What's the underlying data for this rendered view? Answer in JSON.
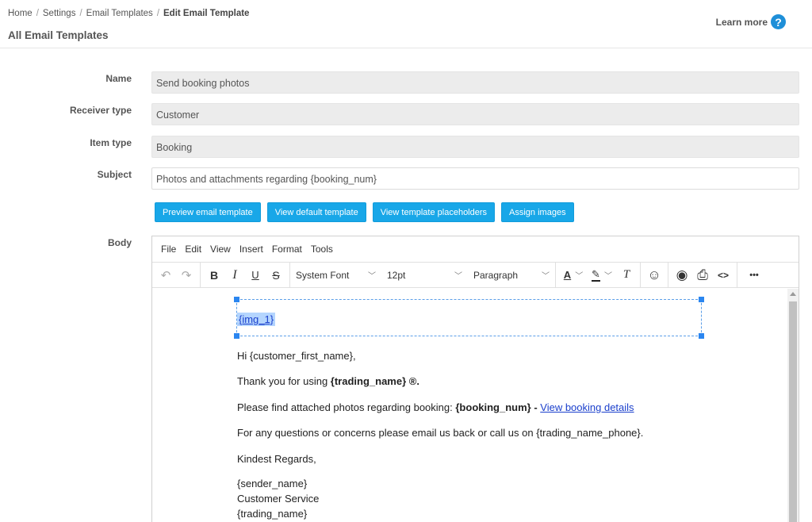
{
  "breadcrumb": {
    "home": "Home",
    "settings": "Settings",
    "templates": "Email Templates",
    "current": "Edit Email Template",
    "separator": "/"
  },
  "page_title": "All Email Templates",
  "learn_more": {
    "label": "Learn more",
    "icon": "help-circle-icon",
    "icon_glyph": "?"
  },
  "form": {
    "name": {
      "label": "Name",
      "value": "Send booking photos"
    },
    "receiver_type": {
      "label": "Receiver type",
      "value": "Customer"
    },
    "item_type": {
      "label": "Item type",
      "value": "Booking"
    },
    "subject": {
      "label": "Subject",
      "value": "Photos and attachments regarding {booking_num}"
    },
    "body_label": "Body"
  },
  "buttons": {
    "preview": "Preview email template",
    "view_default": "View default template",
    "view_placeholders": "View template placeholders",
    "assign_images": "Assign images"
  },
  "editor": {
    "menu": [
      "File",
      "Edit",
      "View",
      "Insert",
      "Format",
      "Tools"
    ],
    "font_family": "System Font",
    "font_size": "12pt",
    "block_format": "Paragraph",
    "toolbar_icons": {
      "undo": "↶",
      "redo": "↷",
      "bold": "B",
      "italic": "I",
      "underline": "U",
      "strike": "S",
      "text_color": "A",
      "highlight": "✎",
      "clear_format": "T",
      "emoji": "☺",
      "preview": "◉",
      "print": "⎙",
      "code": "<>",
      "more": "•••"
    },
    "content": {
      "img_placeholder": "{img_1}",
      "greeting": "Hi {customer_first_name},",
      "thanks_prefix": "Thank you for using ",
      "thanks_bold": "{trading_name} ®.",
      "find_prefix": "Please find attached photos regarding booking: ",
      "find_bold": "{booking_num} - ",
      "find_link": "View booking details",
      "questions": "For any questions or concerns please email us back or call us on {trading_name_phone}.",
      "regards": "Kindest Regards,",
      "sender": "{sender_name}",
      "service": "Customer Service",
      "trading": "{trading_name}"
    }
  },
  "colors": {
    "accent": "#18a7e8",
    "help_icon": "#1e8fd8",
    "link": "#1a3fcc",
    "selection": "#b4d5fe"
  }
}
